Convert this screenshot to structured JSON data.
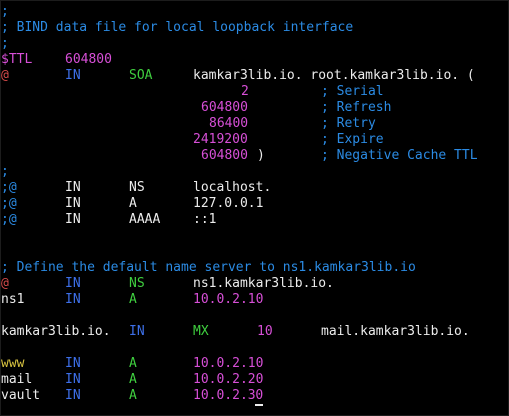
{
  "colors": {
    "background": "#000000",
    "comment": "#2b8be4",
    "text": "#ececec",
    "value": "#d74fd7",
    "origin": "#d34a4a",
    "keyword": "#3fce3f",
    "class": "#3d6fe8",
    "directive": "#d7c340"
  },
  "lines": [
    {
      "segments": [
        {
          "t": ";",
          "c": "comment"
        }
      ]
    },
    {
      "segments": [
        {
          "t": "; BIND data file for local loopback interface",
          "c": "comment"
        }
      ]
    },
    {
      "segments": [
        {
          "t": ";",
          "c": "comment"
        }
      ]
    },
    {
      "segments": [
        {
          "t": "$TTL",
          "c": "magenta"
        },
        {
          "t": "604800",
          "c": "magenta"
        }
      ]
    },
    {
      "segments": [
        {
          "t": "@",
          "c": "red"
        },
        {
          "t": "IN",
          "c": "blue"
        },
        {
          "t": "SOA",
          "c": "green"
        },
        {
          "t": "kamkar3lib.io. root.kamkar3lib.io. (",
          "c": "white"
        }
      ]
    },
    {
      "segments": [
        {
          "t": "2",
          "c": "magenta"
        },
        {
          "t": "; Serial",
          "c": "comment"
        }
      ]
    },
    {
      "segments": [
        {
          "t": "604800",
          "c": "magenta"
        },
        {
          "t": "; Refresh",
          "c": "comment"
        }
      ]
    },
    {
      "segments": [
        {
          "t": "86400",
          "c": "magenta"
        },
        {
          "t": "; Retry",
          "c": "comment"
        }
      ]
    },
    {
      "segments": [
        {
          "t": "2419200",
          "c": "magenta"
        },
        {
          "t": "; Expire",
          "c": "comment"
        }
      ]
    },
    {
      "segments": [
        {
          "t": "604800",
          "c": "magenta"
        },
        {
          "t": ")",
          "c": "white"
        },
        {
          "t": "; Negative Cache TTL",
          "c": "comment"
        }
      ]
    },
    {
      "segments": [
        {
          "t": ";",
          "c": "comment"
        }
      ]
    },
    {
      "segments": [
        {
          "t": ";@",
          "c": "comment"
        },
        {
          "t": "IN",
          "c": "white"
        },
        {
          "t": "NS",
          "c": "white"
        },
        {
          "t": "localhost.",
          "c": "white"
        }
      ]
    },
    {
      "segments": [
        {
          "t": ";@",
          "c": "comment"
        },
        {
          "t": "IN",
          "c": "white"
        },
        {
          "t": "A",
          "c": "white"
        },
        {
          "t": "127.0.0.1",
          "c": "white"
        }
      ]
    },
    {
      "segments": [
        {
          "t": ";@",
          "c": "comment"
        },
        {
          "t": "IN",
          "c": "white"
        },
        {
          "t": "AAAA",
          "c": "white"
        },
        {
          "t": "::1",
          "c": "white"
        }
      ]
    },
    {
      "segments": []
    },
    {
      "segments": []
    },
    {
      "segments": [
        {
          "t": "; Define the default name server to ns1.kamkar3lib.io",
          "c": "comment"
        }
      ]
    },
    {
      "segments": [
        {
          "t": "@",
          "c": "red"
        },
        {
          "t": "IN",
          "c": "blue"
        },
        {
          "t": "NS",
          "c": "green"
        },
        {
          "t": "ns1.kamkar3lib.io.",
          "c": "white"
        }
      ]
    },
    {
      "segments": [
        {
          "t": "ns1",
          "c": "white"
        },
        {
          "t": "IN",
          "c": "blue"
        },
        {
          "t": "A",
          "c": "green"
        },
        {
          "t": "10.0.2.10",
          "c": "magenta"
        }
      ]
    },
    {
      "segments": []
    },
    {
      "segments": [
        {
          "t": "kamkar3lib.io.",
          "c": "white"
        },
        {
          "t": "IN",
          "c": "blue"
        },
        {
          "t": "MX",
          "c": "green"
        },
        {
          "t": "10",
          "c": "magenta"
        },
        {
          "t": "mail.kamkar3lib.io.",
          "c": "white"
        }
      ]
    },
    {
      "segments": []
    },
    {
      "segments": [
        {
          "t": "www",
          "c": "yellow"
        },
        {
          "t": "IN",
          "c": "blue"
        },
        {
          "t": "A",
          "c": "green"
        },
        {
          "t": "10.0.2.10",
          "c": "magenta"
        }
      ]
    },
    {
      "segments": [
        {
          "t": "mail",
          "c": "white"
        },
        {
          "t": "IN",
          "c": "blue"
        },
        {
          "t": "A",
          "c": "green"
        },
        {
          "t": "10.0.2.20",
          "c": "magenta"
        }
      ]
    },
    {
      "segments": [
        {
          "t": "vault",
          "c": "white"
        },
        {
          "t": "IN",
          "c": "blue"
        },
        {
          "t": "A",
          "c": "green"
        },
        {
          "t": "10.0.2.3",
          "c": "magenta"
        },
        {
          "t": "0",
          "c": "magenta",
          "cursor": true
        }
      ]
    }
  ]
}
